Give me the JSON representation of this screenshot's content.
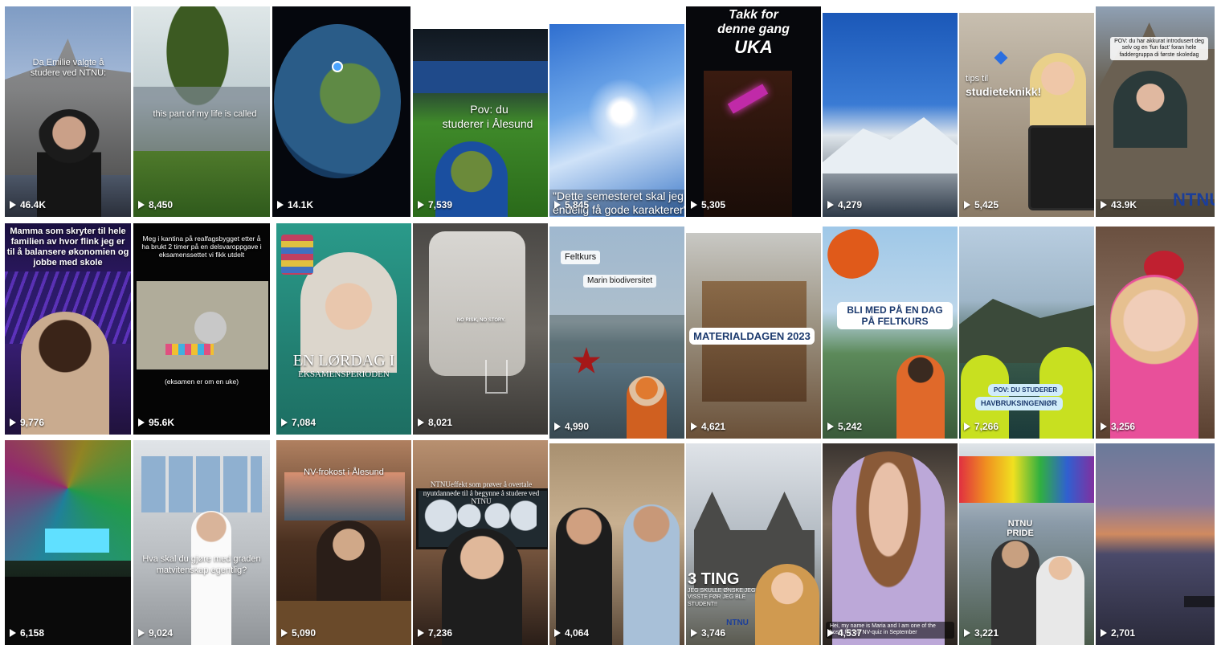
{
  "grid": {
    "tiles": [
      {
        "views": "46.4K",
        "captions": [
          "Da Emilie valgte å studere ved NTNU:"
        ]
      },
      {
        "views": "8,450",
        "captions": [
          "this part of my life is called"
        ]
      },
      {
        "views": "14.1K",
        "captions": []
      },
      {
        "views": "7,539",
        "captions": [
          "Pov: du",
          "studerer i Ålesund"
        ]
      },
      {
        "views": "5,845",
        "captions": [
          "\"Dette semesteret skal jeg endelig få gode karakterer\""
        ]
      },
      {
        "views": "5,305",
        "captions": [
          "Takk for",
          "denne gang",
          "UKA"
        ]
      },
      {
        "views": "4,279",
        "captions": []
      },
      {
        "views": "5,425",
        "captions": [
          "tips til",
          "studieteknikk!"
        ]
      },
      {
        "views": "43.9K",
        "captions": [
          "POV: du har akkurat introdusert deg selv og en 'fun fact' foran hele faddergruppa di første skoledag",
          "NTNU"
        ]
      },
      {
        "views": "9,776",
        "captions": [
          "Mamma som skryter til hele familien av hvor flink jeg er til å balansere økonomien og jobbe med skole"
        ]
      },
      {
        "views": "95.6K",
        "captions": [
          "Meg i kantina på realfagsbygget etter å ha brukt 2 timer på en delsvaroppgave i eksamenssettet vi fikk utdelt",
          "(eksamen er om en uke)"
        ]
      },
      {
        "views": "7,084",
        "captions": [
          "EN LØRDAG I",
          "EKSAMENSPERIODEN"
        ]
      },
      {
        "views": "8,021",
        "captions": [
          "NO RISK, NO STORY."
        ]
      },
      {
        "views": "4,990",
        "captions": [
          "Feltkurs",
          "Marin biodiversitet"
        ]
      },
      {
        "views": "4,621",
        "captions": [
          "MATERIALDAGEN 2023"
        ]
      },
      {
        "views": "5,242",
        "captions": [
          "BLI MED PÅ EN DAG PÅ FELTKURS"
        ]
      },
      {
        "views": "7,266",
        "captions": [
          "POV: DU STUDERER",
          "HAVBRUKSINGENIØR"
        ]
      },
      {
        "views": "3,256",
        "captions": []
      },
      {
        "views": "6,158",
        "captions": []
      },
      {
        "views": "9,024",
        "captions": [
          "Hva skal du gjøre med graden",
          "matvitenskap egentlig?"
        ]
      },
      {
        "views": "5,090",
        "captions": [
          "NV-frokost i Ålesund"
        ]
      },
      {
        "views": "7,236",
        "captions": [
          "NTNUeffekt som prøver å overtale nyutdannede til å begynne å studere ved NTNU"
        ]
      },
      {
        "views": "4,064",
        "captions": []
      },
      {
        "views": "3,746",
        "captions": [
          "3 TING",
          "JEG SKULLE ØNSKE JEG VISSTE FØR JEG BLE STUDENT!!",
          "NTNU"
        ]
      },
      {
        "views": "4,537",
        "captions": [
          "Hei, my name is Maria and I am one of the hosts for the NV-quiz in September"
        ]
      },
      {
        "views": "3,221",
        "captions": [
          "NTNU",
          "PRIDE"
        ]
      },
      {
        "views": "2,701",
        "captions": []
      }
    ]
  },
  "icons": {
    "play": "play-icon"
  }
}
